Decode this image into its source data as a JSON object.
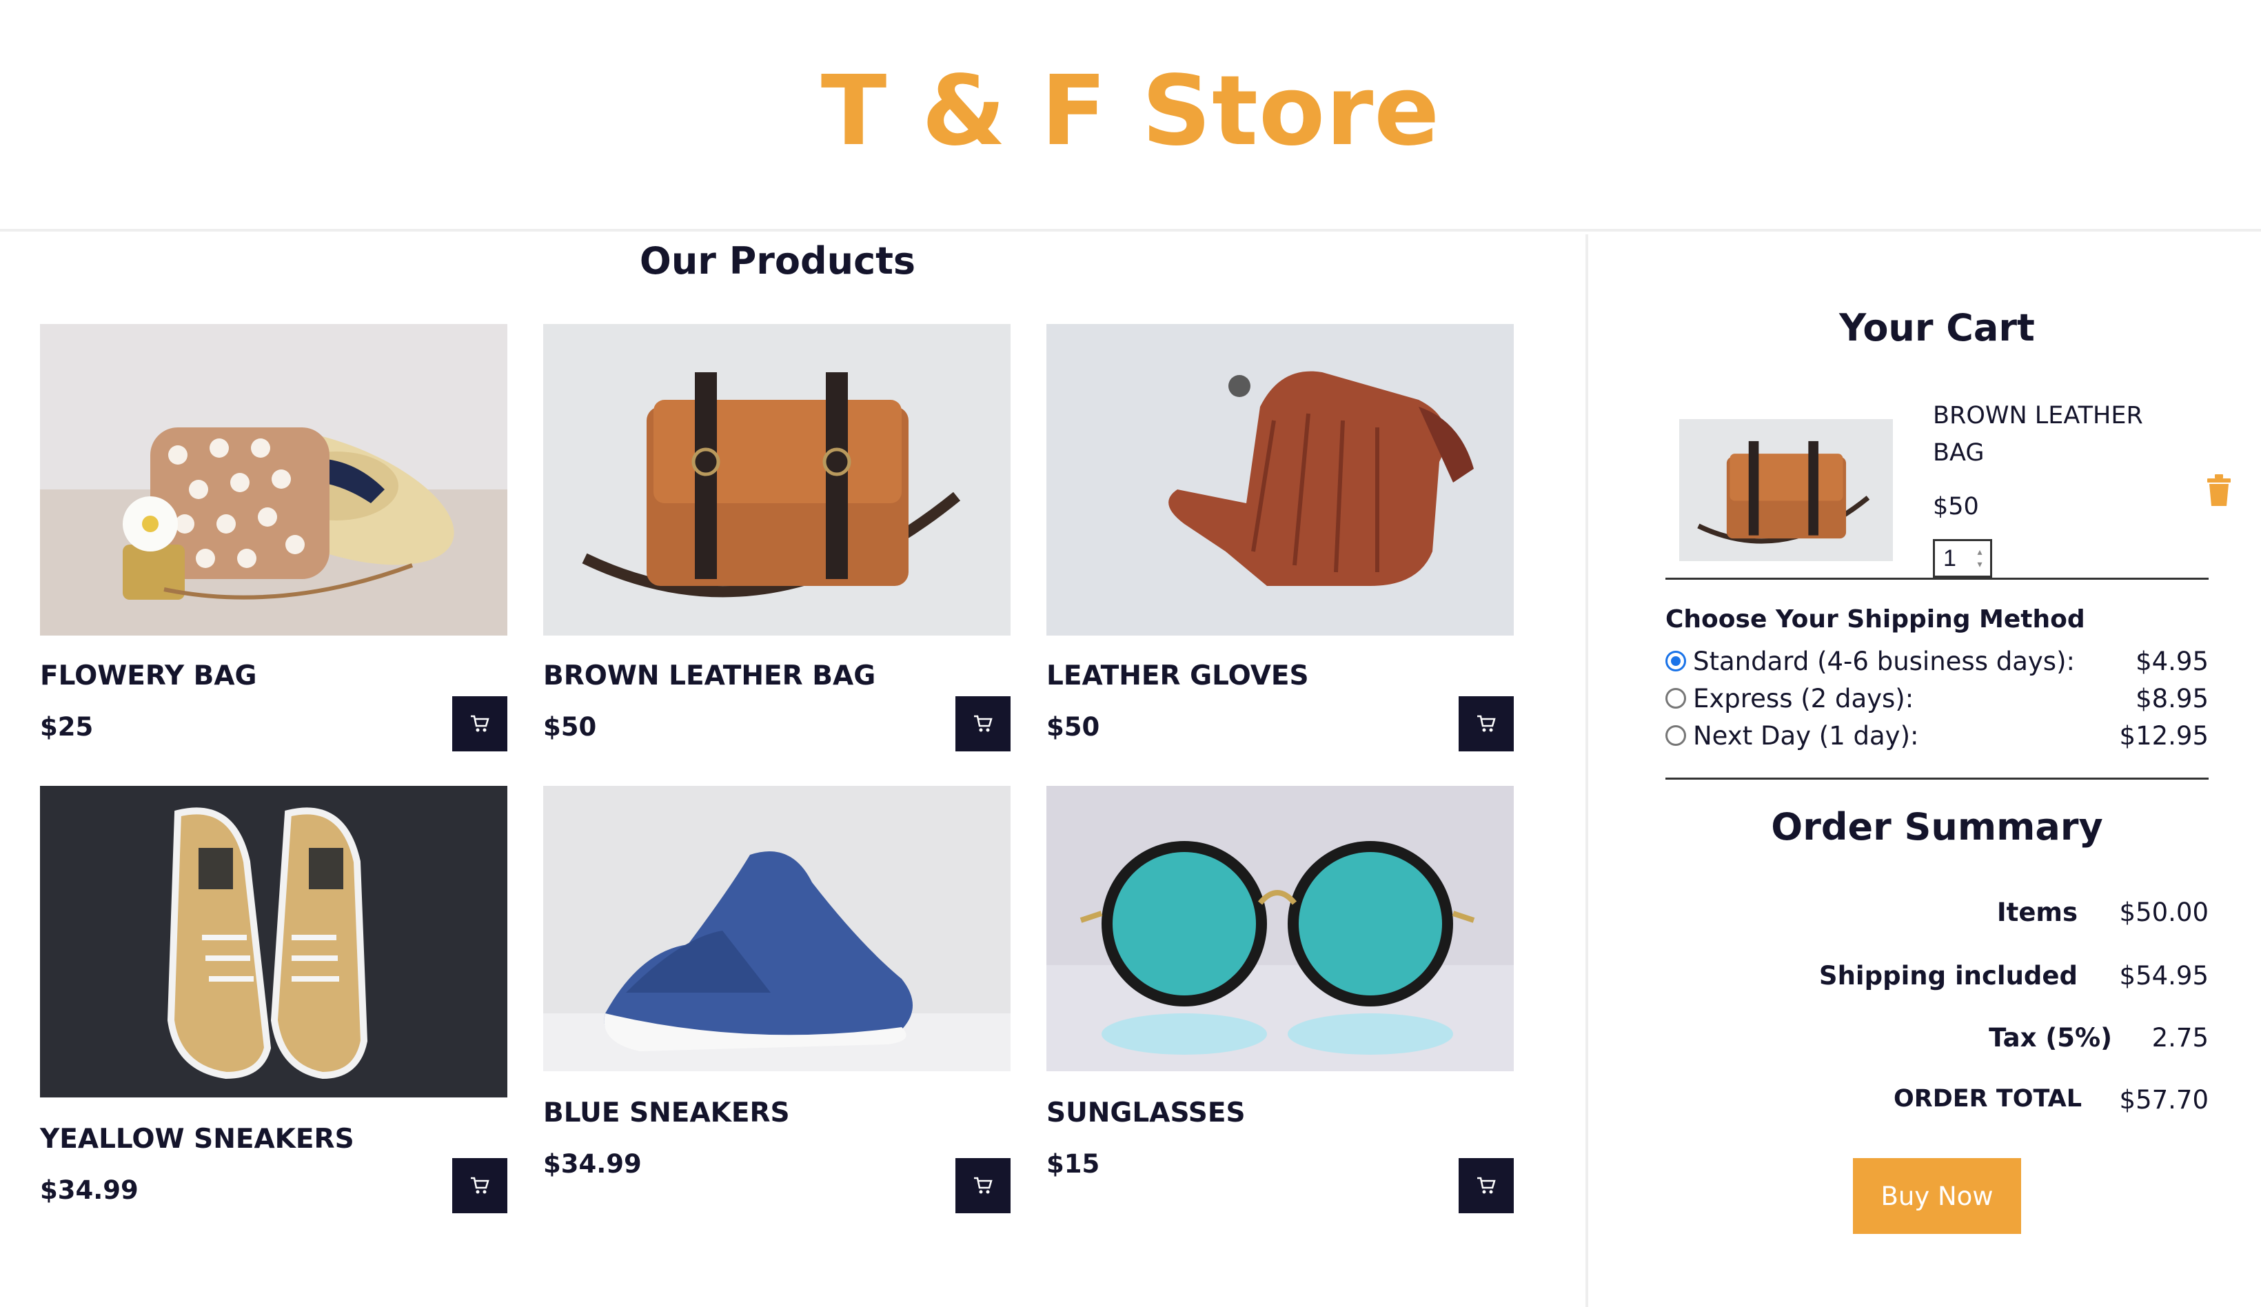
{
  "store": {
    "title": "T & F Store"
  },
  "products": {
    "heading": "Our Products",
    "items": [
      {
        "name": "FLOWERY BAG",
        "price": "$25"
      },
      {
        "name": "BROWN LEATHER BAG",
        "price": "$50"
      },
      {
        "name": "LEATHER GLOVES",
        "price": "$50"
      },
      {
        "name": "YEALLOW SNEAKERS",
        "price": "$34.99"
      },
      {
        "name": "BLUE SNEAKERS",
        "price": "$34.99"
      },
      {
        "name": "SUNGLASSES",
        "price": "$15"
      }
    ]
  },
  "cart": {
    "title": "Your Cart",
    "item": {
      "name": "BROWN LEATHER BAG",
      "price": "$50",
      "quantity": "1"
    },
    "shipping": {
      "title": "Choose Your Shipping Method",
      "options": [
        {
          "label": "Standard (4-6 business days):",
          "price": "$4.95",
          "selected": true
        },
        {
          "label": "Express (2 days):",
          "price": "$8.95",
          "selected": false
        },
        {
          "label": "Next Day (1 day):",
          "price": "$12.95",
          "selected": false
        }
      ]
    },
    "summary": {
      "title": "Order Summary",
      "rows": [
        {
          "label": "Items",
          "value": "$50.00"
        },
        {
          "label": "Shipping included",
          "value": "$54.95"
        },
        {
          "label": "Tax (5%)",
          "value": "2.75"
        },
        {
          "label": "ORDER TOTAL",
          "value": "$57.70"
        }
      ]
    },
    "buy_label": "Buy Now"
  },
  "colors": {
    "accent": "#f0a43a",
    "dark": "#14142b",
    "radio": "#1a73e8"
  }
}
